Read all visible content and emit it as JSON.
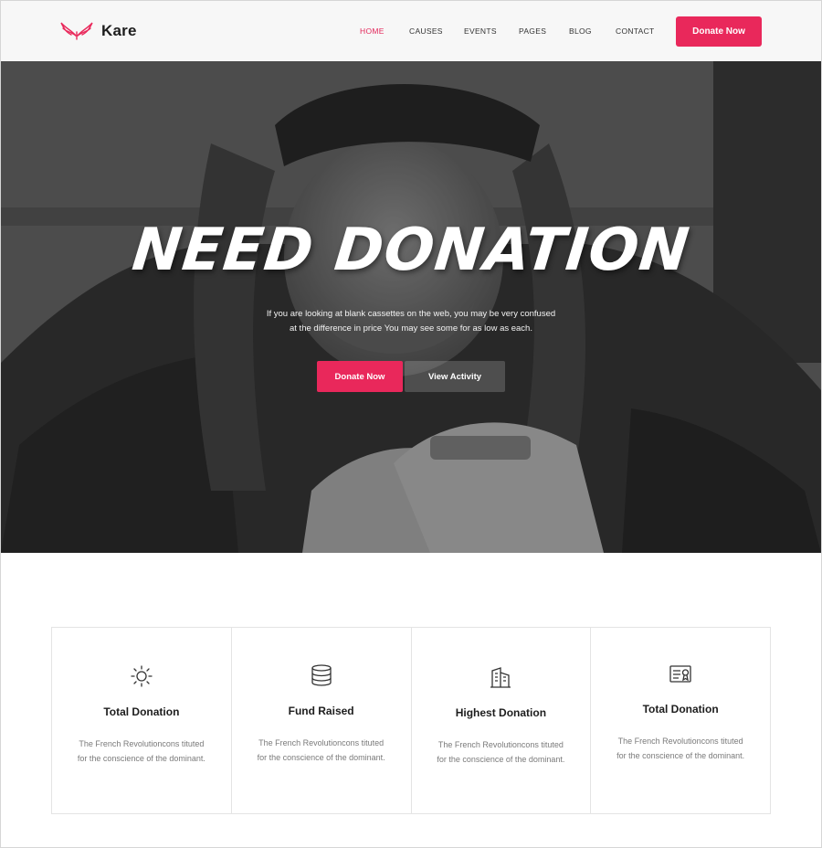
{
  "brand": {
    "name": "Kare",
    "accent": "#e9285b"
  },
  "nav": {
    "items": [
      {
        "label": "HOME",
        "active": true
      },
      {
        "label": "CAUSES"
      },
      {
        "label": "EVENTS"
      },
      {
        "label": "PAGES"
      },
      {
        "label": "BLOG"
      },
      {
        "label": "CONTACT"
      }
    ],
    "cta_label": "Donate Now"
  },
  "hero": {
    "title": "NEED DONATION",
    "text_line1": "If you are looking at blank cassettes on the web, you may be very confused",
    "text_line2": "at the difference in price You may see some for as low as each.",
    "primary_label": "Donate Now",
    "secondary_label": "View Activity"
  },
  "features": [
    {
      "icon": "sun-icon",
      "title": "Total Donation",
      "desc1": "The French Revolutioncons tituted",
      "desc2": "for the conscience of the dominant."
    },
    {
      "icon": "database-icon",
      "title": "Fund Raised",
      "desc1": "The French Revolutioncons tituted",
      "desc2": "for the conscience of the dominant."
    },
    {
      "icon": "building-icon",
      "title": "Highest Donation",
      "desc1": "The French Revolutioncons tituted",
      "desc2": "for the conscience of the dominant."
    },
    {
      "icon": "certificate-icon",
      "title": "Total Donation",
      "desc1": "The French Revolutioncons tituted",
      "desc2": "for the conscience of the dominant."
    }
  ]
}
